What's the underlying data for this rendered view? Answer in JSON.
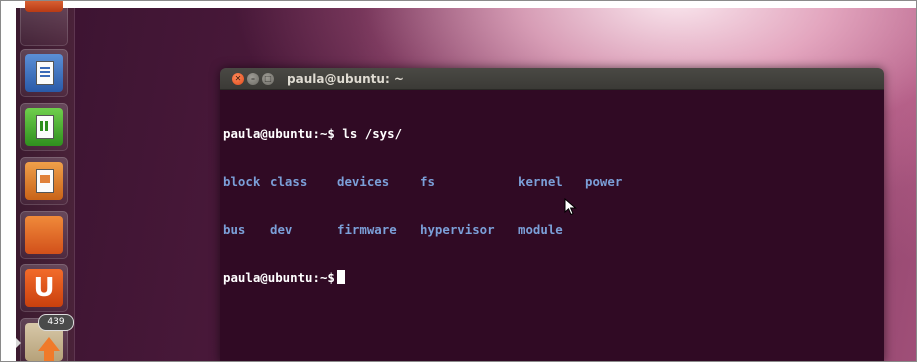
{
  "terminal": {
    "title": "paula@ubuntu: ~",
    "lines": [
      {
        "prompt": "paula@ubuntu:~$",
        "command": " ls /sys/"
      },
      {
        "entries": [
          "block",
          "class",
          "devices",
          "fs",
          "kernel",
          "power"
        ]
      },
      {
        "entries": [
          "bus",
          "dev",
          "firmware",
          "hypervisor",
          "module"
        ]
      },
      {
        "prompt": "paula@ubuntu:~$",
        "command": " "
      }
    ],
    "colors": {
      "background": "#300a24",
      "directory": "#7b9fd8",
      "text": "#ffffff"
    }
  },
  "launcher": {
    "items": [
      {
        "name": "app",
        "icon": "app-icon"
      },
      {
        "name": "LibreOffice Writer",
        "icon": "writer-icon"
      },
      {
        "name": "LibreOffice Calc",
        "icon": "calc-icon"
      },
      {
        "name": "LibreOffice Impress",
        "icon": "impress-icon"
      },
      {
        "name": "Ubuntu Software Center",
        "icon": "software-center-icon"
      },
      {
        "name": "Ubuntu One",
        "icon": "ubuntu-one-icon"
      },
      {
        "name": "Update Manager",
        "icon": "update-manager-icon",
        "badge": "439"
      }
    ]
  }
}
